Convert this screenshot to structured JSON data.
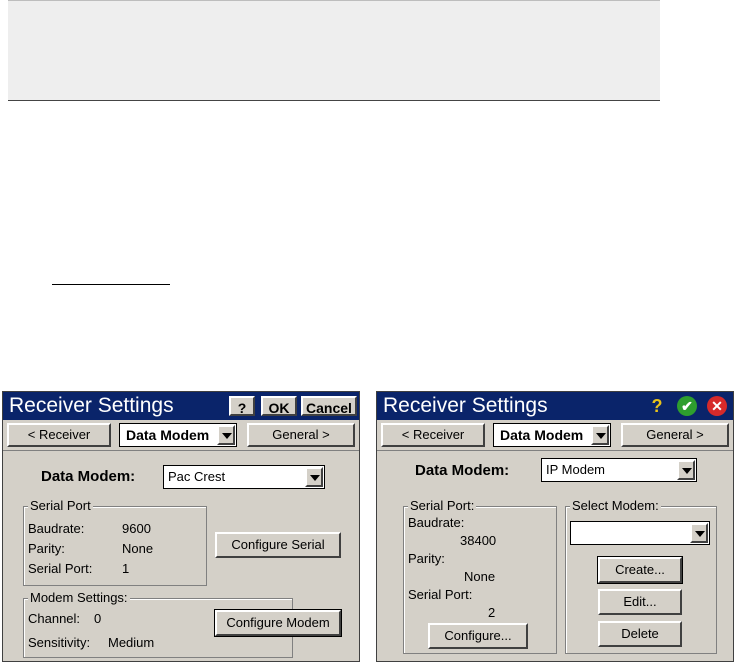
{
  "left_window": {
    "title": "Receiver Settings",
    "buttons": {
      "help": "?",
      "ok": "OK",
      "cancel": "Cancel"
    },
    "tabs": {
      "prev": "< Receiver",
      "current": "Data Modem",
      "next": "General >"
    },
    "data_modem_label": "Data Modem:",
    "data_modem_value": "Pac Crest",
    "serial_port": {
      "group_label": "Serial Port",
      "baudrate_label": "Baudrate:",
      "baudrate_value": "9600",
      "parity_label": "Parity:",
      "parity_value": "None",
      "port_label": "Serial Port:",
      "port_value": "1"
    },
    "configure_serial_label": "Configure Serial",
    "modem_settings": {
      "group_label": "Modem Settings:",
      "channel_label": "Channel:",
      "channel_value": "0",
      "sensitivity_label": "Sensitivity:",
      "sensitivity_value": "Medium"
    },
    "configure_modem_label": "Configure Modem"
  },
  "right_window": {
    "title": "Receiver Settings",
    "icons": [
      "help-icon",
      "ok-icon",
      "close-icon"
    ],
    "tabs": {
      "prev": "< Receiver",
      "current": "Data Modem",
      "next": "General >"
    },
    "data_modem_label": "Data Modem:",
    "data_modem_value": "IP Modem",
    "serial_port": {
      "group_label": "Serial Port:",
      "baudrate_label": "Baudrate:",
      "baudrate_value": "38400",
      "parity_label": "Parity:",
      "parity_value": "None",
      "port_label": "Serial Port:",
      "port_value": "2"
    },
    "configure_label": "Configure...",
    "select_modem": {
      "group_label": "Select Modem:",
      "value": "",
      "create_label": "Create...",
      "edit_label": "Edit...",
      "delete_label": "Delete"
    }
  },
  "colors": {
    "titlebar": "#0a246a",
    "window_bg": "#d4d0c8",
    "ok_icon": "#2e9e2e",
    "close_icon": "#d62a2a",
    "help_icon": "#e8c21a"
  }
}
